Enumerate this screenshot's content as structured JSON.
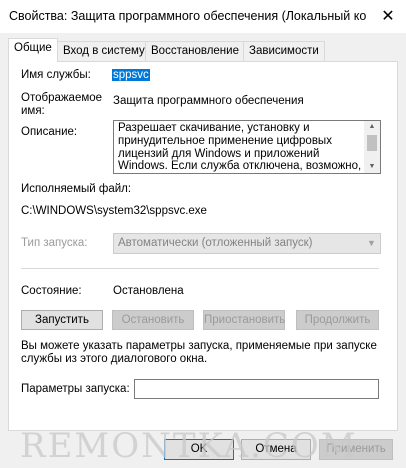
{
  "window": {
    "title": "Свойства: Защита программного обеспечения (Локальный ко",
    "close": "✕"
  },
  "tabs": [
    {
      "label": "Общие",
      "active": true
    },
    {
      "label": "Вход в систему",
      "active": false
    },
    {
      "label": "Восстановление",
      "active": false
    },
    {
      "label": "Зависимости",
      "active": false
    }
  ],
  "general": {
    "service_name_label": "Имя службы:",
    "service_name_value": "sppsvc",
    "display_name_label": "Отображаемое\nимя:",
    "display_name_value": "Защита программного обеспечения",
    "description_label": "Описание:",
    "description_value": "Разрешает скачивание, установку и принудительное применение цифровых лицензий для Windows и приложений Windows. Если служба отключена, возможно,",
    "exe_label": "Исполняемый файл:",
    "exe_value": "C:\\WINDOWS\\system32\\sppsvc.exe",
    "startup_type_label": "Тип запуска:",
    "startup_type_value": "Автоматически (отложенный запуск)",
    "status_label": "Состояние:",
    "status_value": "Остановлена",
    "buttons": {
      "start": "Запустить",
      "stop": "Остановить",
      "pause": "Приостановить",
      "resume": "Продолжить"
    },
    "hint": "Вы можете указать параметры запуска, применяемые при запуске службы из этого диалогового окна.",
    "params_label": "Параметры запуска:",
    "params_value": ""
  },
  "footer": {
    "ok": "OK",
    "cancel": "Отмена",
    "apply": "Применить"
  },
  "watermark": "REMONTKA.COM"
}
